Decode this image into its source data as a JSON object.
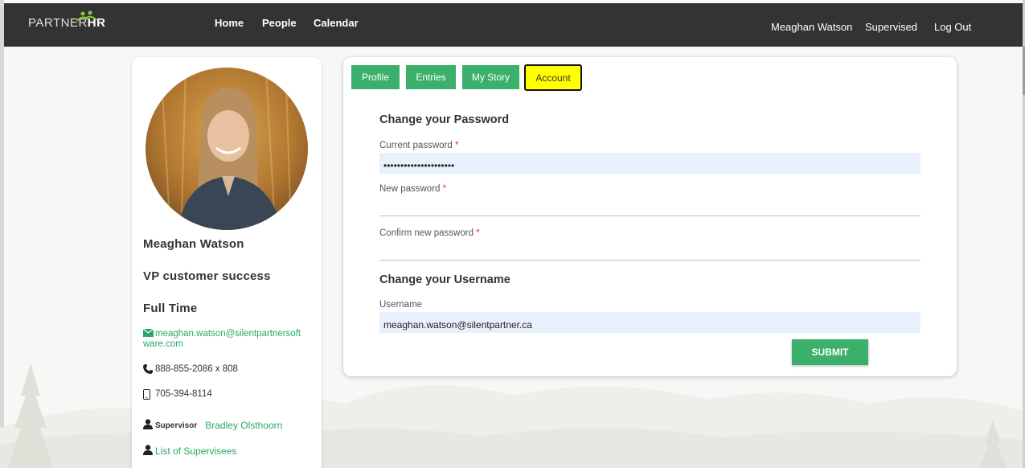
{
  "header": {
    "logo_partner": "PARTNER",
    "logo_hr": "HR",
    "nav": {
      "home": "Home",
      "people": "People",
      "calendar": "Calendar"
    },
    "user_name": "Meaghan Watson",
    "supervised": "Supervised",
    "logout": "Log Out"
  },
  "profile": {
    "name": "Meaghan Watson",
    "title": "VP customer  success",
    "employment": "Full Time",
    "email_line1": "meaghan.watson@silentpartnersoft",
    "email_line2": "ware.com",
    "phone": "888-855-2086 x 808",
    "mobile": "705-394-8114",
    "supervisor_label": "Supervisor",
    "supervisor_name": "Bradley Olsthoorn",
    "supervisees_link": "List of Supervisees"
  },
  "tabs": {
    "profile": "Profile",
    "entries": "Entries",
    "my_story": "My Story",
    "account": "Account"
  },
  "account": {
    "change_password_title": "Change your Password",
    "current_password_label": "Current password",
    "current_password_value": "•••••••••••••••••••••",
    "new_password_label": "New password",
    "confirm_password_label": "Confirm new password",
    "required_mark": "*",
    "change_username_title": "Change your Username",
    "username_label": "Username",
    "username_value": "meaghan.watson@silentpartner.ca",
    "submit_label": "SUBMIT"
  },
  "colors": {
    "topbar": "#333333",
    "accent_green": "#3ab06b",
    "active_tab": "#ffff00"
  },
  "icons": [
    "envelope-icon",
    "phone-icon",
    "mobile-icon",
    "person-icon",
    "person-icon"
  ]
}
